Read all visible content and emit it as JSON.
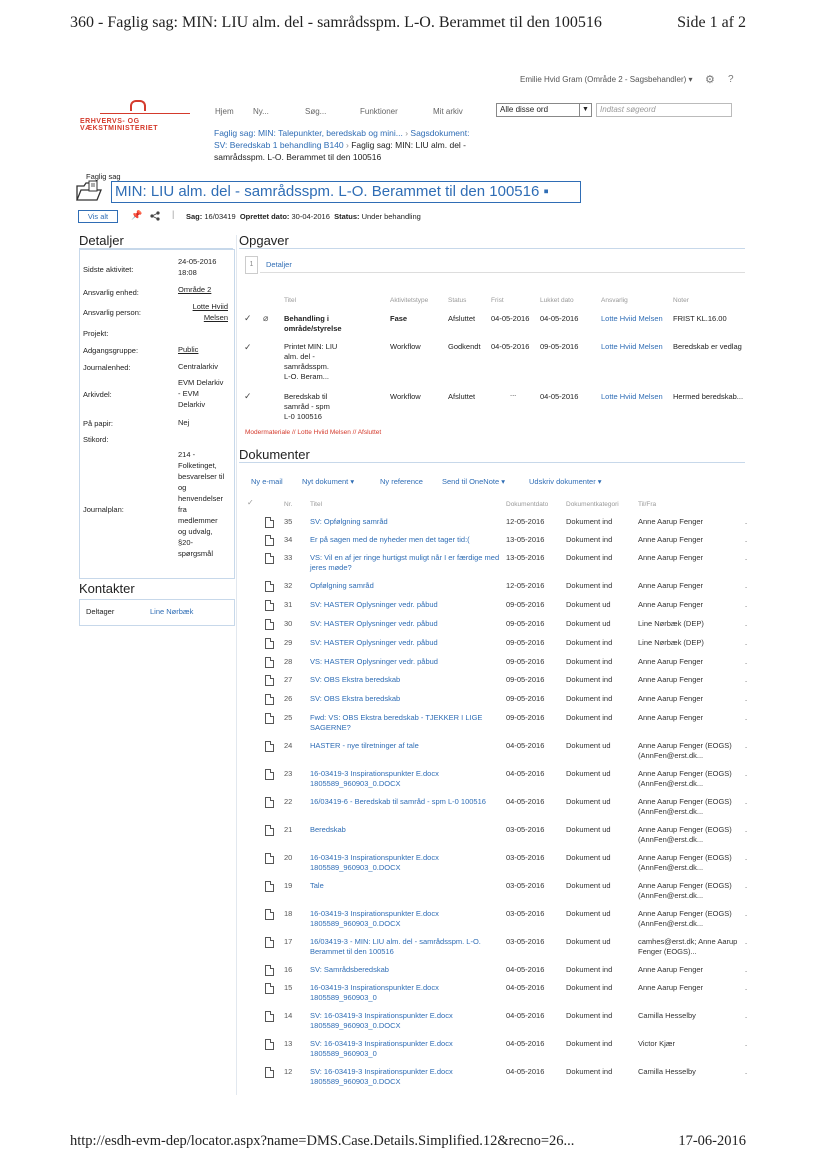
{
  "print_header": {
    "title": "360 - Faglig sag: MIN: LIU alm. del - samrådsspm. L-O. Berammet til den 100516",
    "page": "Side 1 af 2"
  },
  "user_bar": {
    "user": "Emilie Hvid Gram (Område 2 - Sagsbehandler) ▾",
    "settings_icon": "⚙",
    "help_icon": "?"
  },
  "logo": {
    "text": "ERHVERVS- OG VÆKSTMINISTERIET"
  },
  "nav": {
    "items": [
      "Hjem",
      "Ny...",
      "Søg...",
      "Funktioner",
      "Mit arkiv"
    ]
  },
  "search": {
    "scope": "Alle disse ord",
    "placeholder": "Indtast søgeord"
  },
  "breadcrumb": {
    "part1": "Faglig sag: MIN: Talepunkter, beredskab og mini...",
    "sep1": " › ",
    "part2": "Sagsdokument:",
    "part3": "SV: Beredskab 1 behandling B140",
    "sep2": " › ",
    "current": "Faglig sag: MIN: LIU alm. del - samrådsspm. L-O. Berammet til den 100516"
  },
  "case": {
    "label": "Faglig sag",
    "title": "MIN: LIU alm. del - samrådsspm. L-O. Berammet til den 100516 ▪",
    "vis_alt": "Vis alt",
    "sag_label": "Sag:",
    "sag_value": "16/03419",
    "oprettet_label": "Oprettet dato:",
    "oprettet_value": "30-04-2016",
    "status_label": "Status:",
    "status_value": "Under behandling"
  },
  "details": {
    "title": "Detaljer",
    "rows": [
      {
        "label": "Sidste aktivitet:",
        "value": "24-05-2016\n18:08"
      },
      {
        "label": "Ansvarlig enhed:",
        "value": "Område 2"
      },
      {
        "label": "Ansvarlig person:",
        "value": "Lotte Hviid\nMelsen"
      },
      {
        "label": "Projekt:",
        "value": ""
      },
      {
        "label": "Adgangsgruppe:",
        "value": "Public"
      },
      {
        "label": "Journalenhed:",
        "value": "Centralarkiv"
      },
      {
        "label": "Arkivdel:",
        "value": "EVM Delarkiv\n- EVM\nDelarkiv"
      },
      {
        "label": "På papir:",
        "value": "Nej"
      },
      {
        "label": "Stikord:",
        "value": ""
      },
      {
        "label": "Journalplan:",
        "value": "214 -\nFolketinget,\nbesvarelser til\nog\nhenvendelser\nfra\nmedlemmer\nog udvalg,\n§20-\nspørgsmål"
      }
    ]
  },
  "contacts": {
    "title": "Kontakter",
    "role": "Deltager",
    "name": "Line Nørbæk"
  },
  "tasks": {
    "title": "Opgaver",
    "tab_number": "1",
    "tab_label": "Detaljer",
    "headers": [
      "Titel",
      "Aktivitetstype",
      "Status",
      "Frist",
      "Lukket dato",
      "Ansvarlig",
      "Noter"
    ],
    "rows": [
      {
        "title": "Behandling i\nområde/styrelse",
        "type": "Fase",
        "status": "Afsluttet",
        "frist": "04-05-2016",
        "lukket": "04-05-2016",
        "ansvarlig": "Lotte Hviid Melsen",
        "noter": "FRIST KL.16.00"
      },
      {
        "title": "Printet MIN: LIU\nalm. del -\nsamrådsspm.\nL-O. Beram...",
        "type": "Workflow",
        "status": "Godkendt",
        "frist": "04-05-2016",
        "lukket": "09-05-2016",
        "ansvarlig": "Lotte Hviid Melsen",
        "noter": "Beredskab er vedlag"
      },
      {
        "title": "Beredskab til\nsamråd - spm\nL-0 100516",
        "type": "Workflow",
        "status": "Afsluttet",
        "frist": "...",
        "lukket": "04-05-2016",
        "ansvarlig": "Lotte Hviid Melsen",
        "noter": "Hermed beredskab..."
      }
    ],
    "footer_note": "Modermateriale // Lotte Hviid Melsen // Afsluttet"
  },
  "documents": {
    "title": "Dokumenter",
    "toolbar": [
      "Ny e-mail",
      "Nyt dokument ▾",
      "Ny reference",
      "Send til OneNote ▾",
      "Udskriv dokumenter ▾"
    ],
    "headers": [
      "Nr.",
      "Titel",
      "Dokumentdato",
      "Dokumentkategori",
      "Til/Fra"
    ],
    "rows": [
      {
        "nr": "35",
        "title": "SV: Opfølgning samråd",
        "date": "12-05-2016",
        "cat": "Dokument ind",
        "to": "Anne Aarup Fenger"
      },
      {
        "nr": "34",
        "title": "Er på sagen med de nyheder men det tager tid:(",
        "date": "13-05-2016",
        "cat": "Dokument ind",
        "to": "Anne Aarup Fenger"
      },
      {
        "nr": "33",
        "title": "VS: Vil en af jer ringe hurtigst muligt når I er færdige med jeres møde?",
        "date": "13-05-2016",
        "cat": "Dokument ind",
        "to": "Anne Aarup Fenger"
      },
      {
        "nr": "32",
        "title": "Opfølgning samråd",
        "date": "12-05-2016",
        "cat": "Dokument ind",
        "to": "Anne Aarup Fenger"
      },
      {
        "nr": "31",
        "title": "SV: HASTER Oplysninger vedr. påbud",
        "date": "09-05-2016",
        "cat": "Dokument ud",
        "to": "Anne Aarup Fenger"
      },
      {
        "nr": "30",
        "title": "SV: HASTER Oplysninger vedr. påbud",
        "date": "09-05-2016",
        "cat": "Dokument ud",
        "to": "Line Nørbæk (DEP)"
      },
      {
        "nr": "29",
        "title": "SV: HASTER Oplysninger vedr. påbud",
        "date": "09-05-2016",
        "cat": "Dokument ind",
        "to": "Line Nørbæk (DEP)"
      },
      {
        "nr": "28",
        "title": "VS: HASTER Oplysninger vedr. påbud",
        "date": "09-05-2016",
        "cat": "Dokument ind",
        "to": "Anne Aarup Fenger"
      },
      {
        "nr": "27",
        "title": "SV: OBS Ekstra beredskab",
        "date": "09-05-2016",
        "cat": "Dokument ind",
        "to": "Anne Aarup Fenger"
      },
      {
        "nr": "26",
        "title": "SV: OBS Ekstra beredskab",
        "date": "09-05-2016",
        "cat": "Dokument ind",
        "to": "Anne Aarup Fenger"
      },
      {
        "nr": "25",
        "title": "Fwd: VS: OBS Ekstra beredskab - TJEKKER I LIGE SAGERNE?",
        "date": "09-05-2016",
        "cat": "Dokument ind",
        "to": "Anne Aarup Fenger"
      },
      {
        "nr": "24",
        "title": "HASTER - nye tilretninger af tale",
        "date": "04-05-2016",
        "cat": "Dokument ud",
        "to": "Anne Aarup Fenger (EOGS) (AnnFen@erst.dk..."
      },
      {
        "nr": "23",
        "title": "16-03419-3 Inspirationspunkter E.docx 1805589_960903_0.DOCX",
        "date": "04-05-2016",
        "cat": "Dokument ud",
        "to": "Anne Aarup Fenger (EOGS) (AnnFen@erst.dk..."
      },
      {
        "nr": "22",
        "title": "16/03419-6 - Beredskab til samråd - spm L-0 100516",
        "date": "04-05-2016",
        "cat": "Dokument ud",
        "to": "Anne Aarup Fenger (EOGS) (AnnFen@erst.dk..."
      },
      {
        "nr": "21",
        "title": "Beredskab",
        "date": "03-05-2016",
        "cat": "Dokument ud",
        "to": "Anne Aarup Fenger (EOGS) (AnnFen@erst.dk..."
      },
      {
        "nr": "20",
        "title": "16-03419-3 Inspirationspunkter E.docx 1805589_960903_0.DOCX",
        "date": "03-05-2016",
        "cat": "Dokument ud",
        "to": "Anne Aarup Fenger (EOGS) (AnnFen@erst.dk..."
      },
      {
        "nr": "19",
        "title": "Tale",
        "date": "03-05-2016",
        "cat": "Dokument ud",
        "to": "Anne Aarup Fenger (EOGS) (AnnFen@erst.dk..."
      },
      {
        "nr": "18",
        "title": "16-03419-3 Inspirationspunkter E.docx 1805589_960903_0.DOCX",
        "date": "03-05-2016",
        "cat": "Dokument ud",
        "to": "Anne Aarup Fenger (EOGS) (AnnFen@erst.dk..."
      },
      {
        "nr": "17",
        "title": "16/03419-3 - MIN: LIU alm. del - samrådsspm. L-O. Berammet til den 100516",
        "date": "03-05-2016",
        "cat": "Dokument ud",
        "to": "camhes@erst.dk; Anne Aarup Fenger (EOGS)..."
      },
      {
        "nr": "16",
        "title": "SV: Samrådsberedskab",
        "date": "04-05-2016",
        "cat": "Dokument ind",
        "to": "Anne Aarup Fenger"
      },
      {
        "nr": "15",
        "title": "16-03419-3 Inspirationspunkter E.docx 1805589_960903_0",
        "date": "04-05-2016",
        "cat": "Dokument ind",
        "to": "Anne Aarup Fenger"
      },
      {
        "nr": "14",
        "title": "SV: 16-03419-3 Inspirationspunkter E.docx 1805589_960903_0.DOCX",
        "date": "04-05-2016",
        "cat": "Dokument ind",
        "to": "Camilla Hesselby"
      },
      {
        "nr": "13",
        "title": "SV: 16-03419-3 Inspirationspunkter E.docx 1805589_960903_0",
        "date": "04-05-2016",
        "cat": "Dokument ind",
        "to": "Victor Kjær"
      },
      {
        "nr": "12",
        "title": "SV: 16-03419-3 Inspirationspunkter E.docx 1805589_960903_0.DOCX",
        "date": "04-05-2016",
        "cat": "Dokument ind",
        "to": "Camilla Hesselby"
      }
    ]
  },
  "print_footer": {
    "url": "http://esdh-evm-dep/locator.aspx?name=DMS.Case.Details.Simplified.12&recno=26...",
    "date": "17-06-2016"
  },
  "colors": {
    "link": "#2f6db5",
    "logo": "#d43a2c",
    "rule": "#c7d8ea"
  }
}
